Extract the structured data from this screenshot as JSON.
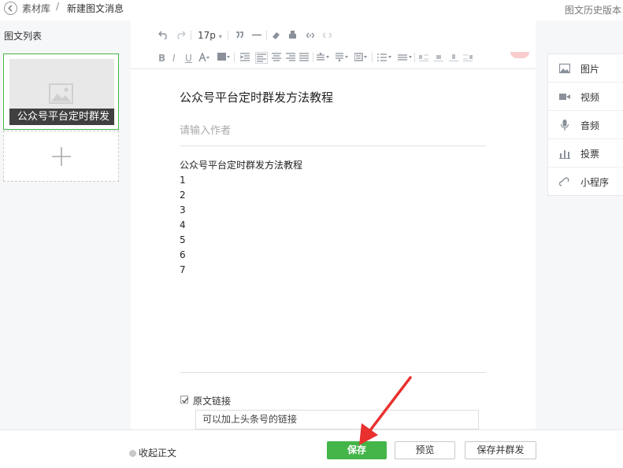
{
  "topbar": {
    "breadcrumb_root": "素材库",
    "breadcrumb_sep": "/",
    "breadcrumb_current": "新建图文消息",
    "history": "图文历史版本"
  },
  "left": {
    "title": "图文列表",
    "card_title": "公众号平台定时群发"
  },
  "toolbar": {
    "font_size": "17p",
    "font_size_caret": "▾"
  },
  "editor": {
    "title": "公众号平台定时群发方法教程",
    "author_placeholder": "请输入作者",
    "body_lines": [
      "公众号平台定时群发方法教程",
      "1",
      "2",
      "3",
      "4",
      "5",
      "6",
      "7"
    ],
    "original_link_label": "原文链接",
    "original_link_checked": true,
    "original_link_placeholder": "可以加上头条号的链接"
  },
  "side_panel": {
    "items": [
      {
        "label": "图片",
        "icon": "image-icon"
      },
      {
        "label": "视频",
        "icon": "video-icon"
      },
      {
        "label": "音频",
        "icon": "audio-icon"
      },
      {
        "label": "投票",
        "icon": "vote-icon"
      },
      {
        "label": "小程序",
        "icon": "mini-program-icon"
      }
    ]
  },
  "bottombar": {
    "collapse": "收起正文",
    "save": "保存",
    "preview": "预览",
    "save_publish": "保存并群发"
  },
  "colors": {
    "accent_green": "#44b549",
    "annotation_arrow": "#e8312f"
  }
}
